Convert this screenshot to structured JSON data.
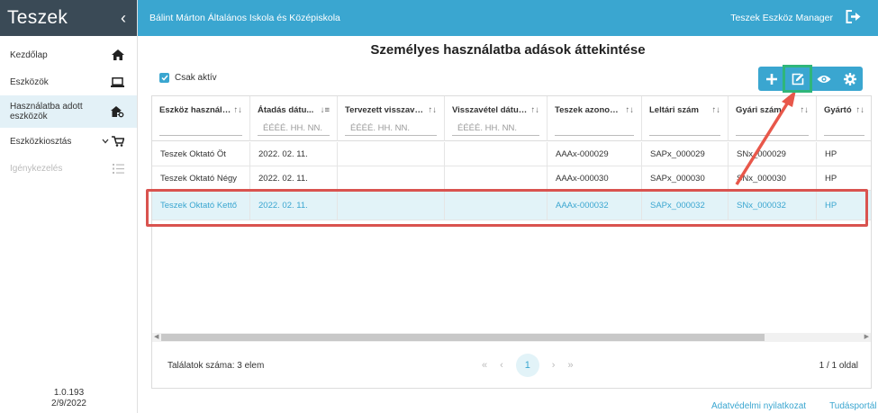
{
  "app": {
    "title": "Teszek",
    "version": "1.0.193",
    "date": "2/9/2022"
  },
  "sidebar": {
    "items": [
      {
        "label": "Kezdőlap",
        "icon": "home-icon"
      },
      {
        "label": "Eszközök",
        "icon": "laptop-icon"
      },
      {
        "label": "Használatba adott eszközök",
        "icon": "house-key-icon"
      },
      {
        "label": "Eszközkiosztás",
        "icon": "cart-icon"
      },
      {
        "label": "Igénykezelés",
        "icon": "list-icon"
      }
    ]
  },
  "header": {
    "organization": "Bálint Márton Általános Iskola és Középiskola",
    "app_name": "Teszek Eszköz Manager"
  },
  "page": {
    "title": "Személyes használatba adások áttekintése"
  },
  "filter": {
    "label": "Csak aktív",
    "checked": true
  },
  "grid": {
    "columns": [
      {
        "label": "Eszköz használó...",
        "filter_placeholder": ""
      },
      {
        "label": "Átadás dátu...",
        "filter_placeholder": "ÉÉÉÉ. HH. NN."
      },
      {
        "label": "Tervezett visszavét...",
        "filter_placeholder": "ÉÉÉÉ. HH. NN."
      },
      {
        "label": "Visszavétel dátuma",
        "filter_placeholder": "ÉÉÉÉ. HH. NN."
      },
      {
        "label": "Teszek azonosí...",
        "filter_placeholder": ""
      },
      {
        "label": "Leltári szám",
        "filter_placeholder": ""
      },
      {
        "label": "Gyári szám",
        "filter_placeholder": ""
      },
      {
        "label": "Gyártó",
        "filter_placeholder": ""
      }
    ],
    "rows": [
      [
        "Teszek Oktató Öt",
        "2022. 02. 11.",
        "",
        "",
        "AAAx-000029",
        "SAPx_000029",
        "SNx_000029",
        "HP"
      ],
      [
        "Teszek Oktató Négy",
        "2022. 02. 11.",
        "",
        "",
        "AAAx-000030",
        "SAPx_000030",
        "SNx_000030",
        "HP"
      ],
      [
        "Teszek Oktató Kettő",
        "2022. 02. 11.",
        "",
        "",
        "AAAx-000032",
        "SAPx_000032",
        "SNx_000032",
        "HP"
      ]
    ],
    "selected_row": 2
  },
  "pager": {
    "count_text": "Találatok száma: 3 elem",
    "current_page": "1",
    "page_info": "1 / 1 oldal"
  },
  "footer": {
    "privacy": "Adatvédelmi nyilatkozat",
    "portal": "Tudásportál"
  },
  "colors": {
    "accent": "#3aa6d0",
    "sidebar_dark": "#3a4a56",
    "highlight_red": "#d9534f",
    "highlight_green": "#2fb67a"
  }
}
